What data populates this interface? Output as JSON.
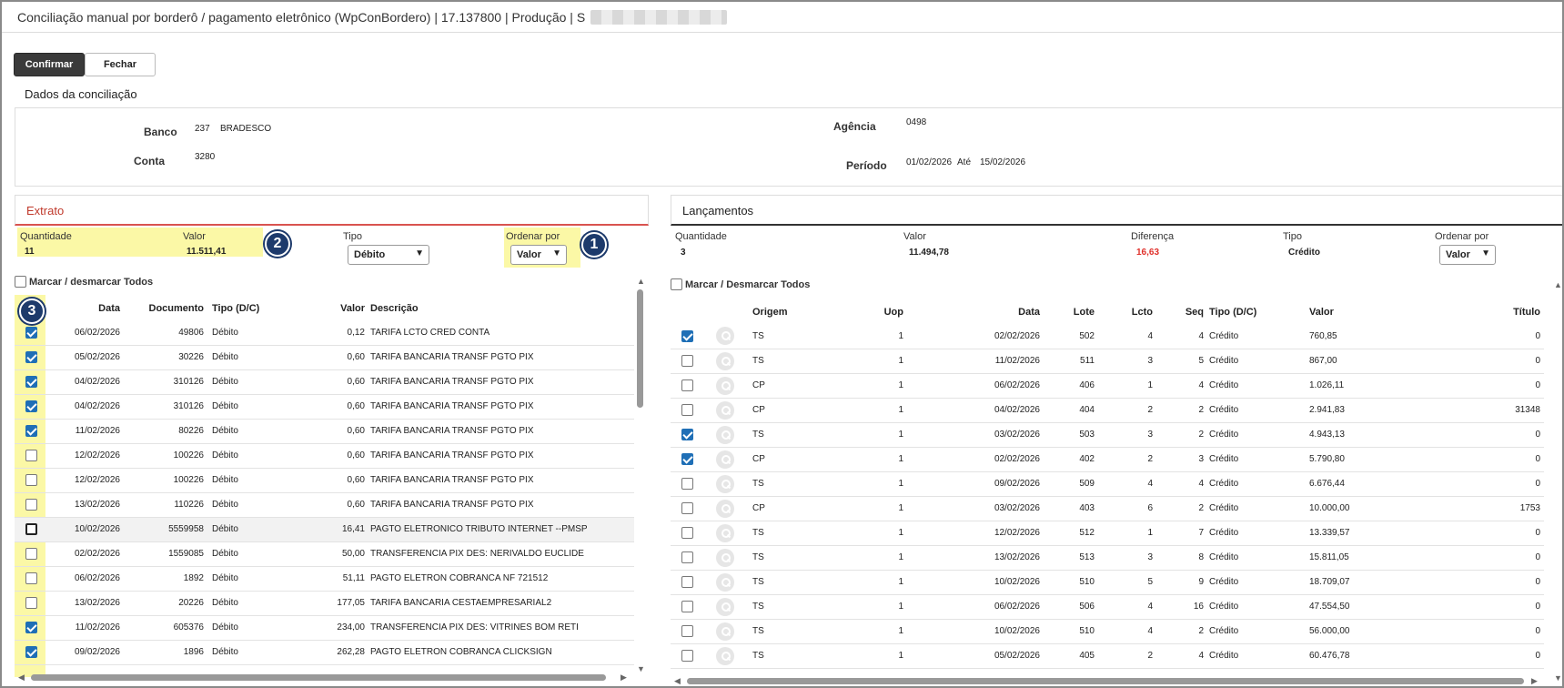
{
  "window": {
    "title": "Conciliação manual por borderô / pagamento eletrônico (WpConBordero) | 17.137800 | Produção | S"
  },
  "toolbar": {
    "confirm_label": "Confirmar",
    "close_label": "Fechar"
  },
  "dados": {
    "header": "Dados da conciliação",
    "banco_label": "Banco",
    "banco_code": "237",
    "banco_name": "BRADESCO",
    "conta_label": "Conta",
    "conta_value": "3280",
    "agencia_label": "Agência",
    "agencia_value": "0498",
    "periodo_label": "Período",
    "periodo_from": "01/02/2026",
    "ate_label": "Até",
    "periodo_to": "15/02/2026"
  },
  "extrato": {
    "header": "Extrato",
    "quantidade_label": "Quantidade",
    "quantidade_value": "11",
    "valor_label": "Valor",
    "valor_value": "11.511,41",
    "tipo_label": "Tipo",
    "tipo_value": "Débito",
    "ordenar_label": "Ordenar por",
    "ordenar_value": "Valor",
    "marcar_label": "Marcar / desmarcar Todos",
    "columns": [
      "Data",
      "Documento",
      "Tipo (D/C)",
      "Valor",
      "Descrição"
    ],
    "rows": [
      {
        "checked": true,
        "data": "06/02/2026",
        "doc": "49806",
        "tipo": "Débito",
        "valor": "0,12",
        "desc": "TARIFA LCTO CRED CONTA"
      },
      {
        "checked": true,
        "data": "05/02/2026",
        "doc": "30226",
        "tipo": "Débito",
        "valor": "0,60",
        "desc": "TARIFA BANCARIA TRANSF PGTO PIX"
      },
      {
        "checked": true,
        "data": "04/02/2026",
        "doc": "310126",
        "tipo": "Débito",
        "valor": "0,60",
        "desc": "TARIFA BANCARIA TRANSF PGTO PIX"
      },
      {
        "checked": true,
        "data": "04/02/2026",
        "doc": "310126",
        "tipo": "Débito",
        "valor": "0,60",
        "desc": "TARIFA BANCARIA TRANSF PGTO PIX"
      },
      {
        "checked": true,
        "data": "11/02/2026",
        "doc": "80226",
        "tipo": "Débito",
        "valor": "0,60",
        "desc": "TARIFA BANCARIA TRANSF PGTO PIX"
      },
      {
        "checked": false,
        "data": "12/02/2026",
        "doc": "100226",
        "tipo": "Débito",
        "valor": "0,60",
        "desc": "TARIFA BANCARIA TRANSF PGTO PIX"
      },
      {
        "checked": false,
        "data": "12/02/2026",
        "doc": "100226",
        "tipo": "Débito",
        "valor": "0,60",
        "desc": "TARIFA BANCARIA TRANSF PGTO PIX"
      },
      {
        "checked": false,
        "data": "13/02/2026",
        "doc": "110226",
        "tipo": "Débito",
        "valor": "0,60",
        "desc": "TARIFA BANCARIA TRANSF PGTO PIX"
      },
      {
        "checked": false,
        "focus": true,
        "data": "10/02/2026",
        "doc": "5559958",
        "tipo": "Débito",
        "valor": "16,41",
        "desc": "PAGTO ELETRONICO TRIBUTO INTERNET --PMSP"
      },
      {
        "checked": false,
        "data": "02/02/2026",
        "doc": "1559085",
        "tipo": "Débito",
        "valor": "50,00",
        "desc": "TRANSFERENCIA PIX DES: NERIVALDO EUCLIDE"
      },
      {
        "checked": false,
        "data": "06/02/2026",
        "doc": "1892",
        "tipo": "Débito",
        "valor": "51,11",
        "desc": "PAGTO ELETRON COBRANCA NF 721512"
      },
      {
        "checked": false,
        "data": "13/02/2026",
        "doc": "20226",
        "tipo": "Débito",
        "valor": "177,05",
        "desc": "TARIFA BANCARIA CESTAEMPRESARIAL2"
      },
      {
        "checked": true,
        "data": "11/02/2026",
        "doc": "605376",
        "tipo": "Débito",
        "valor": "234,00",
        "desc": "TRANSFERENCIA PIX DES: VITRINES BOM RETI"
      },
      {
        "checked": true,
        "data": "09/02/2026",
        "doc": "1896",
        "tipo": "Débito",
        "valor": "262,28",
        "desc": "PAGTO ELETRON COBRANCA CLICKSIGN"
      }
    ]
  },
  "lancamentos": {
    "header": "Lançamentos",
    "quantidade_label": "Quantidade",
    "quantidade_value": "3",
    "valor_label": "Valor",
    "valor_value": "11.494,78",
    "diferenca_label": "Diferença",
    "diferenca_value": "16,63",
    "tipo_label": "Tipo",
    "tipo_value": "Crédito",
    "ordenar_label": "Ordenar por",
    "ordenar_value": "Valor",
    "marcar_label": "Marcar / Desmarcar Todos",
    "columns": [
      "Origem",
      "Uop",
      "Data",
      "Lote",
      "Lcto",
      "Seq",
      "Tipo (D/C)",
      "Valor",
      "Título"
    ],
    "rows": [
      {
        "checked": true,
        "origem": "TS",
        "uop": "1",
        "data": "02/02/2026",
        "lote": "502",
        "lcto": "4",
        "seq": "4",
        "tipo": "Crédito",
        "valor": "760,85",
        "titulo": "0"
      },
      {
        "checked": false,
        "origem": "TS",
        "uop": "1",
        "data": "11/02/2026",
        "lote": "511",
        "lcto": "3",
        "seq": "5",
        "tipo": "Crédito",
        "valor": "867,00",
        "titulo": "0"
      },
      {
        "checked": false,
        "origem": "CP",
        "uop": "1",
        "data": "06/02/2026",
        "lote": "406",
        "lcto": "1",
        "seq": "4",
        "tipo": "Crédito",
        "valor": "1.026,11",
        "titulo": "0"
      },
      {
        "checked": false,
        "origem": "CP",
        "uop": "1",
        "data": "04/02/2026",
        "lote": "404",
        "lcto": "2",
        "seq": "2",
        "tipo": "Crédito",
        "valor": "2.941,83",
        "titulo": "31348"
      },
      {
        "checked": true,
        "origem": "TS",
        "uop": "1",
        "data": "03/02/2026",
        "lote": "503",
        "lcto": "3",
        "seq": "2",
        "tipo": "Crédito",
        "valor": "4.943,13",
        "titulo": "0"
      },
      {
        "checked": true,
        "origem": "CP",
        "uop": "1",
        "data": "02/02/2026",
        "lote": "402",
        "lcto": "2",
        "seq": "3",
        "tipo": "Crédito",
        "valor": "5.790,80",
        "titulo": "0"
      },
      {
        "checked": false,
        "origem": "TS",
        "uop": "1",
        "data": "09/02/2026",
        "lote": "509",
        "lcto": "4",
        "seq": "4",
        "tipo": "Crédito",
        "valor": "6.676,44",
        "titulo": "0"
      },
      {
        "checked": false,
        "origem": "CP",
        "uop": "1",
        "data": "03/02/2026",
        "lote": "403",
        "lcto": "6",
        "seq": "2",
        "tipo": "Crédito",
        "valor": "10.000,00",
        "titulo": "1753"
      },
      {
        "checked": false,
        "origem": "TS",
        "uop": "1",
        "data": "12/02/2026",
        "lote": "512",
        "lcto": "1",
        "seq": "7",
        "tipo": "Crédito",
        "valor": "13.339,57",
        "titulo": "0"
      },
      {
        "checked": false,
        "origem": "TS",
        "uop": "1",
        "data": "13/02/2026",
        "lote": "513",
        "lcto": "3",
        "seq": "8",
        "tipo": "Crédito",
        "valor": "15.811,05",
        "titulo": "0"
      },
      {
        "checked": false,
        "origem": "TS",
        "uop": "1",
        "data": "10/02/2026",
        "lote": "510",
        "lcto": "5",
        "seq": "9",
        "tipo": "Crédito",
        "valor": "18.709,07",
        "titulo": "0"
      },
      {
        "checked": false,
        "origem": "TS",
        "uop": "1",
        "data": "06/02/2026",
        "lote": "506",
        "lcto": "4",
        "seq": "16",
        "tipo": "Crédito",
        "valor": "47.554,50",
        "titulo": "0"
      },
      {
        "checked": false,
        "origem": "TS",
        "uop": "1",
        "data": "10/02/2026",
        "lote": "510",
        "lcto": "4",
        "seq": "2",
        "tipo": "Crédito",
        "valor": "56.000,00",
        "titulo": "0"
      },
      {
        "checked": false,
        "origem": "TS",
        "uop": "1",
        "data": "05/02/2026",
        "lote": "405",
        "lcto": "2",
        "seq": "4",
        "tipo": "Crédito",
        "valor": "60.476,78",
        "titulo": "0"
      }
    ]
  },
  "badges": [
    "1",
    "2",
    "3"
  ],
  "colors": {
    "highlight": "#fbf8a6",
    "badge": "#1d3a6b",
    "checkbox": "#1f6fb6",
    "extrato_accent": "#d9534f",
    "diferenca": "#e0302a"
  },
  "icons": [
    "chevron-down-icon",
    "search-icon",
    "scroll-up-arrow",
    "scroll-down-arrow",
    "scroll-left-arrow",
    "scroll-right-arrow"
  ]
}
